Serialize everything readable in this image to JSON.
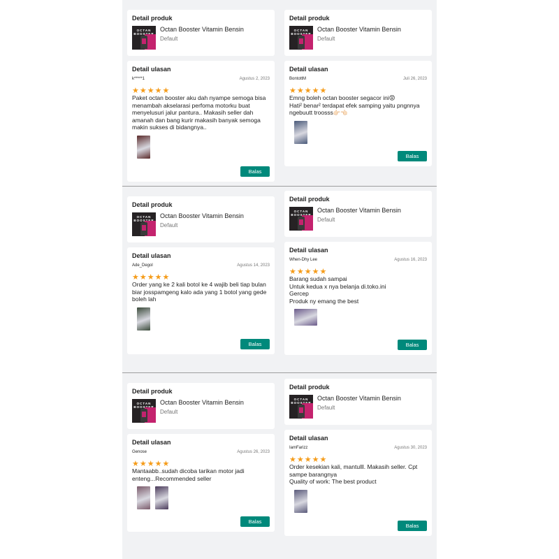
{
  "accent_color": "#00897b",
  "star_color": "#f59c1a",
  "product_section_title": "Detail produk",
  "review_section_title": "Detail ulasan",
  "product": {
    "name": "Octan Booster Vitamin Bensin",
    "variant": "Default",
    "image_text": "OCTAN BOOSTER",
    "image_icon": "product-thumbnail"
  },
  "reply_label": "Balas",
  "reviews": [
    {
      "reviewer": "k*****1",
      "date": "Agustus 2, 2023",
      "rating": 5,
      "text": "Paket octan booster aku dah nyampe semoga bisa menambah akselarasi perfoma motorku buat menyelusuri jalur pantura.. Makasih seller dah amanah dan bang kurir makasih banyak semoga makin sukses di bidangnya..",
      "photo_colors": [
        "#5a2a2a"
      ]
    },
    {
      "reviewer": "BontottM",
      "date": "Juli 26, 2023",
      "rating": 5,
      "text": "Emng boleh octan booster segacor ini😡\nHati² benar² terdapat efek samping yaitu pngnnya ngebuutt troosss👉🏻👈🏻",
      "photo_colors": [
        "#4a5a7a"
      ]
    },
    {
      "reviewer": "Ade_Degol",
      "date": "Agustus 14, 2023",
      "rating": 5,
      "text": "Order yang ke 2 kali botol ke 4 wajib beli tiap bulan biar josspamgeng kalo ada yang 1 botol yang gede boleh lah",
      "photo_colors": [
        "#3a4a3a"
      ]
    },
    {
      "reviewer": "When-Dhy Lee",
      "date": "Agustus 16, 2023",
      "rating": 5,
      "text": "Barang sudah sampai\nUntuk kedua x nya belanja di.toko.ini\nGercep\nProduk ny emang the best",
      "photo_colors": [
        "#6a5a8a"
      ]
    },
    {
      "reviewer": "Genose",
      "date": "Agustus 26, 2023",
      "rating": 5,
      "text": "Mantaabb..sudah dicoba tarikan motor jadi enteng...Recommended seller",
      "photo_colors": [
        "#7a5a6a",
        "#4a3a5a"
      ]
    },
    {
      "reviewer": "IamFarizz",
      "date": "Agustus 30, 2023",
      "rating": 5,
      "text": "Order kesekian kali, mantulll. Makasih seller. Cpt sampe barangnya\nQuality of work: The best product",
      "photo_colors": [
        "#5a5a7a"
      ]
    }
  ]
}
